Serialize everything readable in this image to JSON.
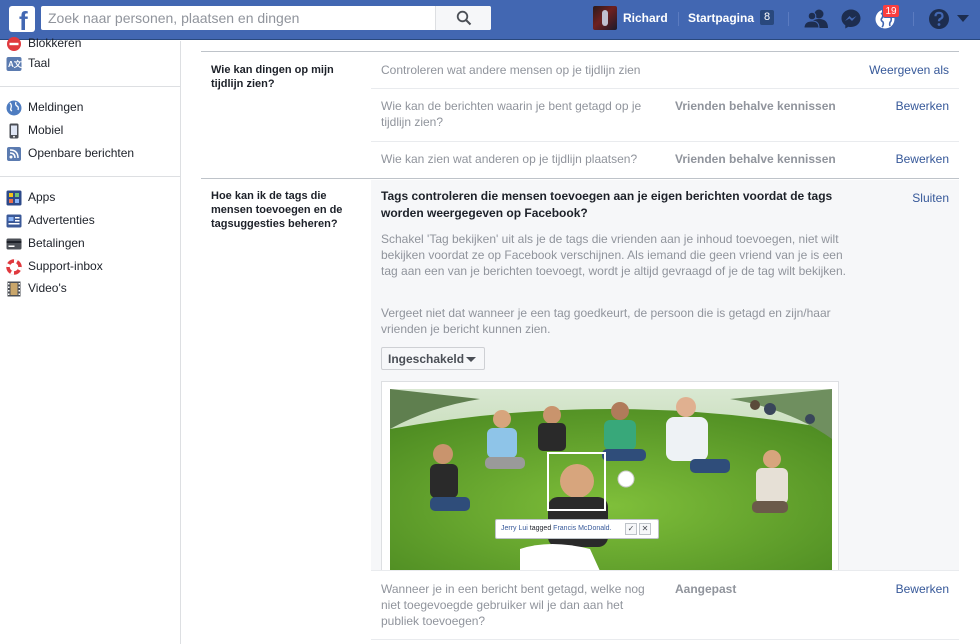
{
  "topbar": {
    "logo": "f",
    "search_placeholder": "Zoek naar personen, plaatsen en dingen",
    "search_icon": "search-icon",
    "profile_name": "Richard",
    "home_label": "Startpagina",
    "home_count": "8",
    "notification_count": "19",
    "icons": [
      "friends-icon",
      "messenger-icon",
      "notifications-globe-icon",
      "help-icon",
      "caret-down-icon"
    ],
    "brand_color": "#4267b2"
  },
  "sidebar": {
    "group1": [
      {
        "label": "Blokkeren",
        "icon": "block-icon"
      },
      {
        "label": "Taal",
        "icon": "language-icon"
      }
    ],
    "group2": [
      {
        "label": "Meldingen",
        "icon": "globe-icon"
      },
      {
        "label": "Mobiel",
        "icon": "mobile-icon"
      },
      {
        "label": "Openbare berichten",
        "icon": "rss-icon"
      }
    ],
    "group3": [
      {
        "label": "Apps",
        "icon": "apps-icon"
      },
      {
        "label": "Advertenties",
        "icon": "ads-icon"
      },
      {
        "label": "Betalingen",
        "icon": "payments-icon"
      },
      {
        "label": "Support-inbox",
        "icon": "lifebuoy-icon"
      },
      {
        "label": "Video's",
        "icon": "film-icon"
      }
    ]
  },
  "main": {
    "section1": {
      "question": "Wie kan dingen op mijn tijdlijn zien?",
      "rows": [
        {
          "text": "Controleren wat andere mensen op je tijdlijn zien",
          "value": "",
          "link": "Weergeven als"
        },
        {
          "text": "Wie kan de berichten waarin je bent getagd op je tijdlijn zien?",
          "value": "Vrienden behalve kennissen",
          "link": "Bewerken"
        },
        {
          "text": "Wie kan zien wat anderen op je tijdlijn plaatsen?",
          "value": "Vrienden behalve kennissen",
          "link": "Bewerken"
        }
      ]
    },
    "section2": {
      "question": "Hoe kan ik de tags die mensen toevoegen en de tagsuggesties beheren?",
      "expanded": {
        "title": "Tags controleren die mensen toevoegen aan je eigen berichten voordat de tags worden weergegeven op Facebook?",
        "close_link": "Sluiten",
        "paragraph1": "Schakel 'Tag bekijken' uit als je de tags die vrienden aan je inhoud toevoegen, niet wilt bekijken voordat ze op Facebook verschijnen. Als iemand die geen vriend van je is een tag aan een van je berichten toevoegt, wordt je altijd gevraagd of je de tag wilt bekijken.",
        "paragraph2": "Vergeet niet dat wanneer je een tag goedkeurt, de persoon die is getagd en zijn/haar vrienden je bericht kunnen zien.",
        "dropdown_value": "Ingeschakeld",
        "photo_tag": {
          "tagger": "Jerry Lui",
          "verb": "tagged",
          "tagged": "Francis McDonald."
        }
      },
      "last_row": {
        "text": "Wanneer je in een bericht bent getagd, welke nog niet toegevoegde gebruiker wil je dan aan het publiek toevoegen?",
        "value": "Aangepast",
        "link": "Bewerken"
      }
    }
  }
}
